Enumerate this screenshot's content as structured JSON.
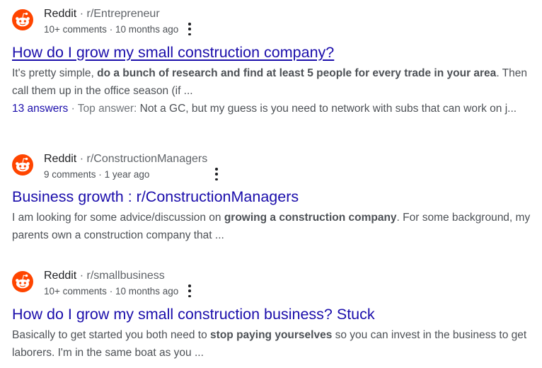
{
  "results": [
    {
      "site": "Reddit",
      "path": "r/Entrepreneur",
      "comments": "10+ comments",
      "age": "10 months ago",
      "title": "How do I grow my small construction company?",
      "snippet_pre": "It's pretty simple, ",
      "snippet_bold": "do a bunch of research and find at least 5 people for every trade in your area",
      "snippet_post": ". Then call them up in the office season (if ...",
      "answers_count": "13 answers",
      "answers_label": "Top answer:",
      "answers_text": "Not a GC, but my guess is you need to network with subs that can work on j..."
    },
    {
      "site": "Reddit",
      "path": "r/ConstructionManagers",
      "comments": "9 comments",
      "age": "1 year ago",
      "title": "Business growth : r/ConstructionManagers",
      "snippet_pre": "I am looking for some advice/discussion on ",
      "snippet_bold": "growing a construction company",
      "snippet_post": ". For some background, my parents own a construction company that ..."
    },
    {
      "site": "Reddit",
      "path": "r/smallbusiness",
      "comments": "10+ comments",
      "age": "10 months ago",
      "title": "How do I grow my small construction business? Stuck",
      "snippet_pre": "Basically to get started you both need to ",
      "snippet_bold": "stop paying yourselves",
      "snippet_post": " so you can invest in the business to get laborers. I'm in the same boat as you ..."
    }
  ],
  "separators": {
    "path": "·",
    "meta": "·"
  },
  "icons": {
    "favicon": "reddit-logo-icon",
    "menu": "more-vert-icon"
  },
  "colors": {
    "link": "#1a0dab",
    "reddit": "#ff4500",
    "text": "#4d5156"
  }
}
